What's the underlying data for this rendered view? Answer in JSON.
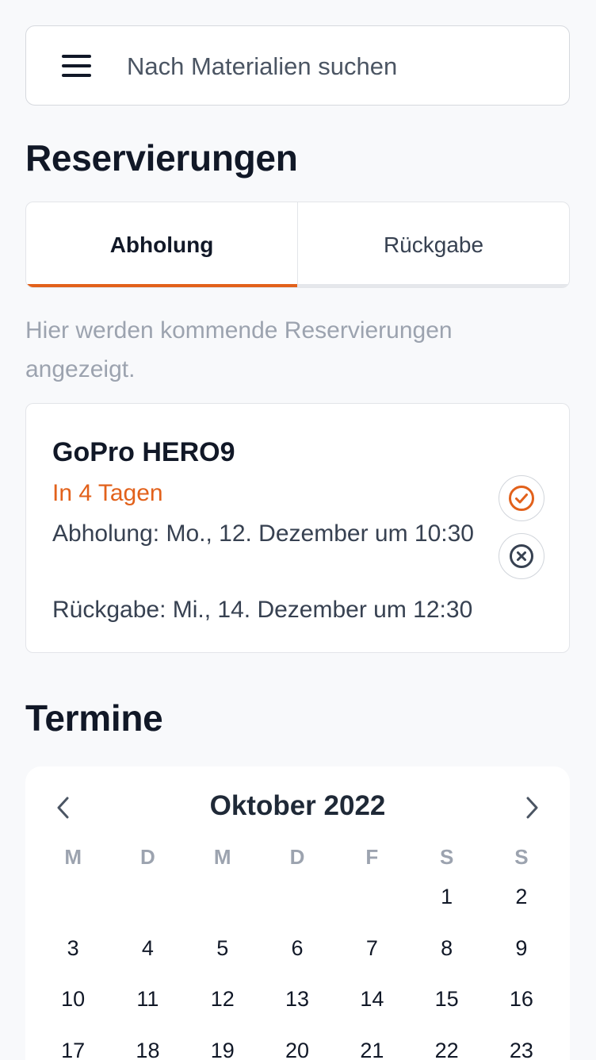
{
  "search": {
    "placeholder": "Nach Materialien suchen"
  },
  "reservations": {
    "title": "Reservierungen",
    "tabs": [
      {
        "label": "Abholung",
        "active": true
      },
      {
        "label": "Rückgabe",
        "active": false
      }
    ],
    "hint": "Hier werden kommende Reservierungen angezeigt.",
    "items": [
      {
        "name": "GoPro HERO9",
        "due": "In 4 Tagen",
        "pickup": "Abholung: Mo., 12. Dezember um 10:30",
        "return": "Rückgabe: Mi., 14. Dezember um 12:30",
        "confirm_icon": "check-circle-icon",
        "cancel_icon": "x-circle-icon"
      }
    ]
  },
  "appointments": {
    "title": "Termine",
    "calendar": {
      "month": "Oktober 2022",
      "weekdays": [
        "M",
        "D",
        "M",
        "D",
        "F",
        "S",
        "S"
      ],
      "weeks": [
        [
          "",
          "",
          "",
          "",
          "",
          "1",
          "2"
        ],
        [
          "3",
          "4",
          "5",
          "6",
          "7",
          "8",
          "9"
        ],
        [
          "10",
          "11",
          "12",
          "13",
          "14",
          "15",
          "16"
        ],
        [
          "17",
          "18",
          "19",
          "20",
          "21",
          "22",
          "23"
        ]
      ]
    }
  },
  "colors": {
    "accent": "#e2611b",
    "text": "#111827",
    "muted": "#9ca3af",
    "background": "#f8f9fb"
  }
}
